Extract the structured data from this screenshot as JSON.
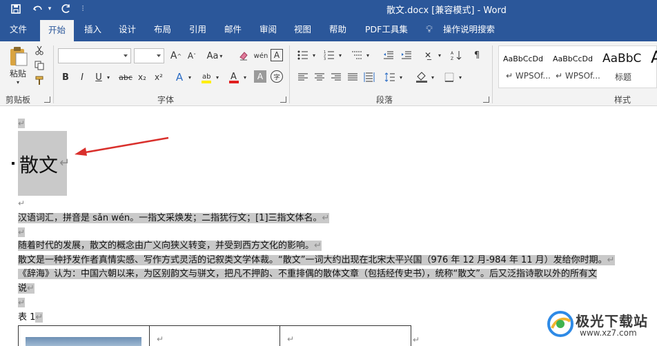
{
  "titlebar": {
    "doc_title": "散文.docx [兼容模式]  -  Word",
    "quick_access": [
      "save-icon",
      "undo-icon",
      "redo-icon",
      "customize-icon"
    ]
  },
  "tabs": [
    "文件",
    "开始",
    "插入",
    "设计",
    "布局",
    "引用",
    "邮件",
    "审阅",
    "视图",
    "帮助",
    "PDF工具集",
    "操作说明搜索"
  ],
  "ribbon": {
    "clipboard": {
      "paste_label": "粘贴",
      "group_label": "剪贴板"
    },
    "font": {
      "font_name_value": "",
      "font_size_value": "",
      "group_label": "字体",
      "grow_label": "A",
      "shrink_label": "A",
      "case_label": "Aa",
      "pinyin_label": "wén",
      "bold": "B",
      "italic": "I",
      "underline": "U",
      "strike": "abc",
      "subscript": "x₂",
      "superscript": "x²",
      "font_color": "A",
      "char_shade": "A",
      "enclose": "字"
    },
    "paragraph": {
      "group_label": "段落"
    },
    "styles": {
      "group_label": "样式",
      "items": [
        {
          "sample": "AaBbCcDd",
          "name": "↵ WPSOf..."
        },
        {
          "sample": "AaBbCcDd",
          "name": "↵ WPSOf..."
        },
        {
          "sample": "AaBbC",
          "name": "标题"
        },
        {
          "sample": "A",
          "name": ""
        }
      ]
    }
  },
  "document": {
    "heading": "散文",
    "mark": "↵",
    "lines": [
      "汉语词汇，拼音是 sǎn wén。一指文采焕发；二指犹行文；[1]三指文体名。",
      "随着时代的发展，散文的概念由广义向狭义转变，并受到西方文化的影响。",
      "散文是一种抒发作者真情实感、写作方式灵活的记叙类文学体裁。“散文”一词大约出现在北宋太平兴国（976 年 12 月-984 年 11 月）发给你时期。",
      "《辞海》认为：中国六朝以来，为区别韵文与骈文，把凡不押韵、不重排偶的散体文章（包括经传史书），统称“散文”。后又泛指诗歌以外的所有文",
      "说",
      "表 1"
    ]
  },
  "watermark": {
    "name": "极光下载站",
    "url": "www.xz7.com"
  },
  "colors": {
    "brand": "#2b579a",
    "highlight": "#c9c9c9",
    "arrow": "#d9302c"
  }
}
